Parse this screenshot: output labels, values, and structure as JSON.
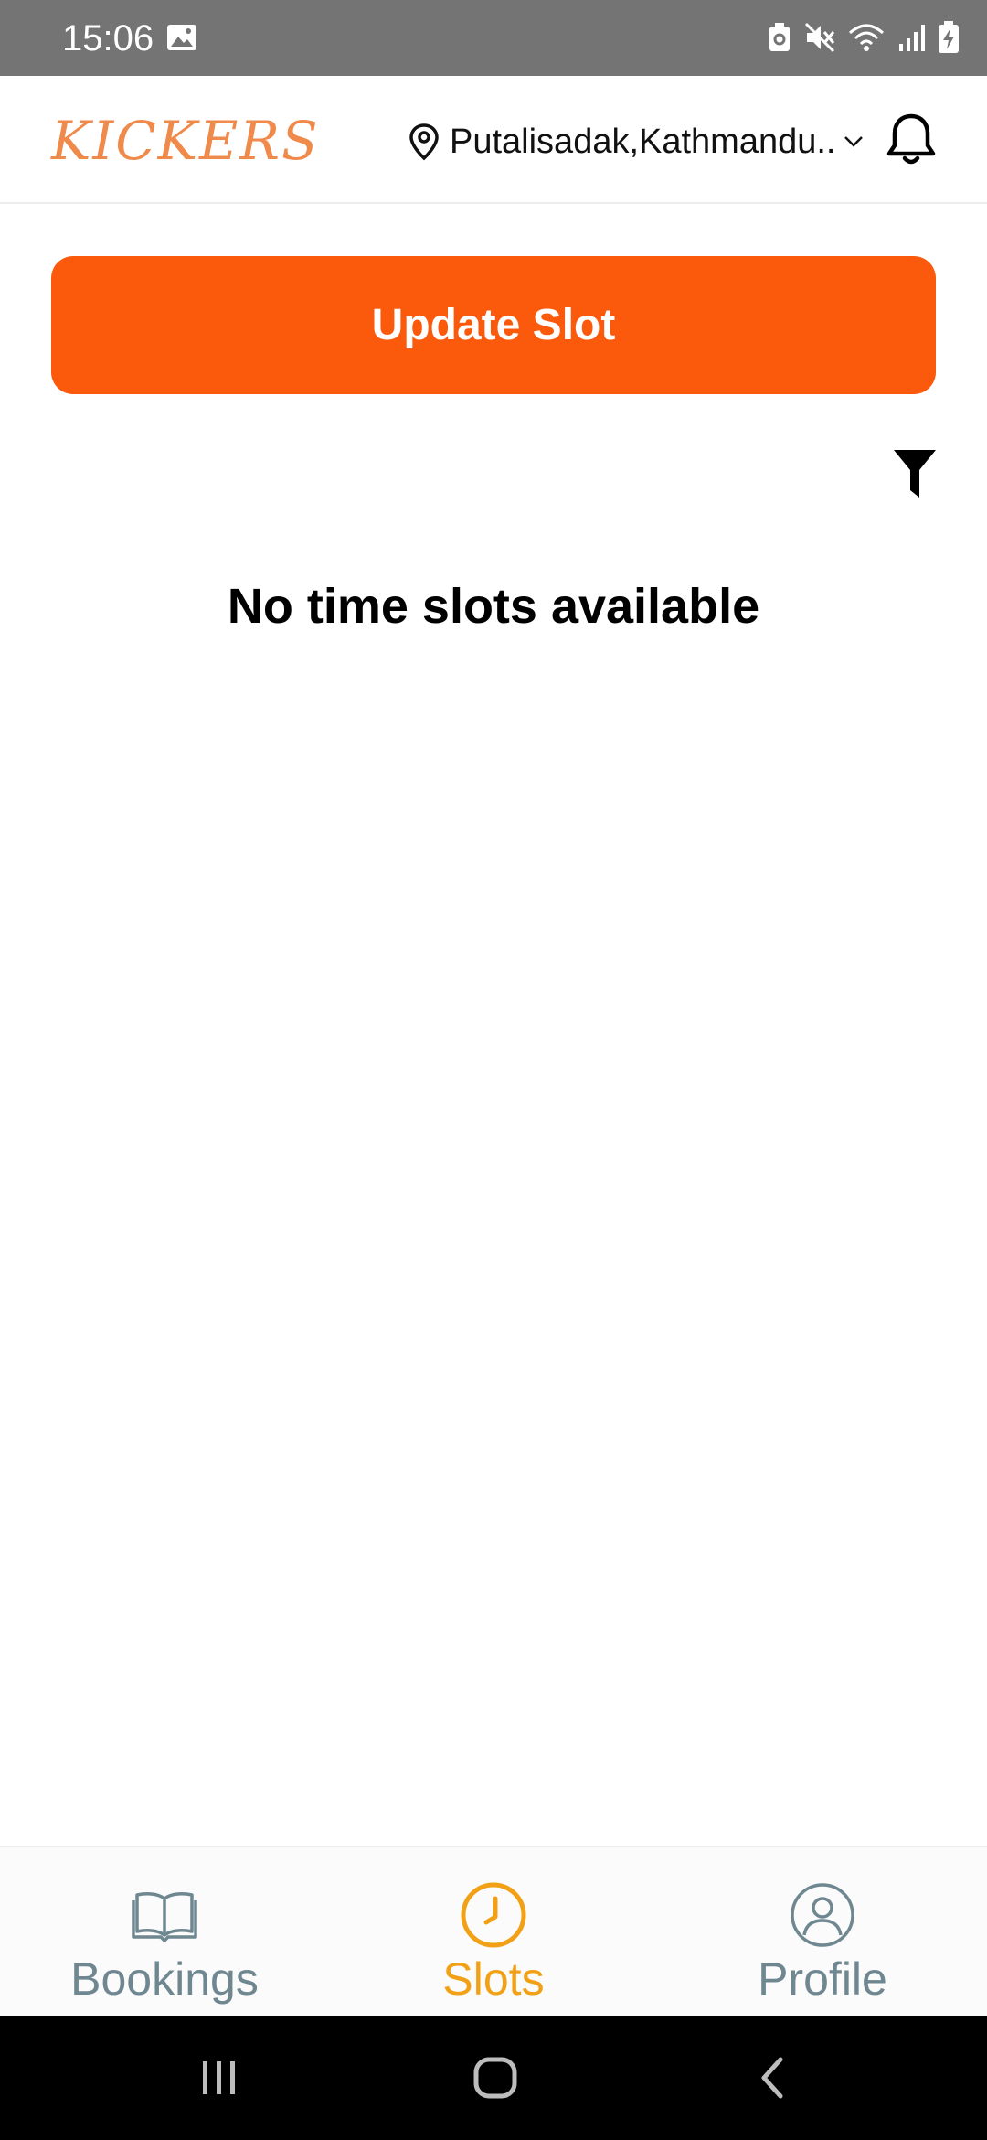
{
  "status_bar": {
    "time": "15:06",
    "icons": [
      "gallery-icon",
      "battery-saver-icon",
      "mute-icon",
      "wifi-icon",
      "signal-icon",
      "battery-charging-icon"
    ]
  },
  "header": {
    "brand": "KICKERS",
    "location": "Putalisadak,Kathmandu..",
    "icons": [
      "location-pin-icon",
      "chevron-down-icon",
      "bell-icon"
    ]
  },
  "main": {
    "update_button": "Update Slot",
    "filter_icon": "filter-icon",
    "empty_message": "No time slots available"
  },
  "bottom_nav": {
    "items": [
      {
        "label": "Bookings",
        "icon": "book-icon",
        "active": false
      },
      {
        "label": "Slots",
        "icon": "clock-icon",
        "active": true
      },
      {
        "label": "Profile",
        "icon": "profile-icon",
        "active": false
      }
    ]
  },
  "colors": {
    "accent": "#fb5a0c",
    "brand": "#f08a4b",
    "active_tab": "#f2a116",
    "inactive_tab": "#6f8790",
    "status_bar": "#747474"
  }
}
